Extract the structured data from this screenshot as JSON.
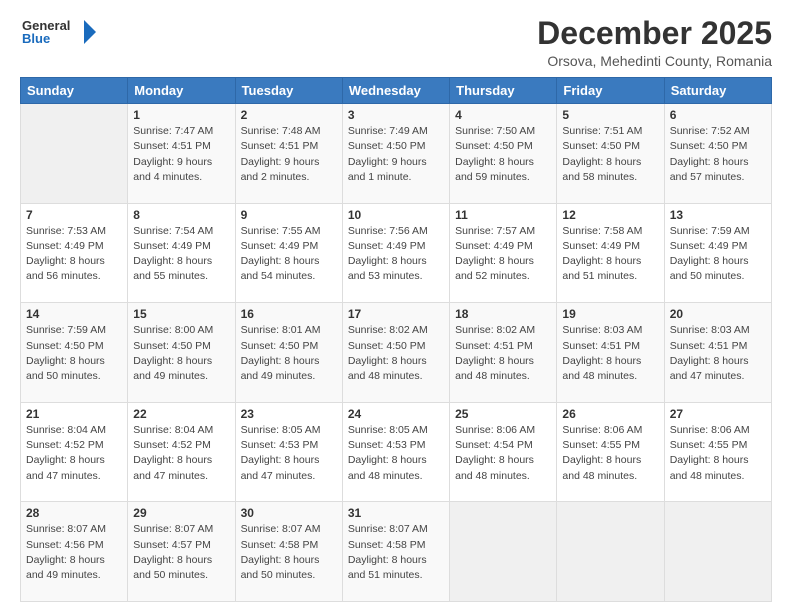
{
  "logo": {
    "line1": "General",
    "line2": "Blue"
  },
  "title": "December 2025",
  "subtitle": "Orsova, Mehedinti County, Romania",
  "days_header": [
    "Sunday",
    "Monday",
    "Tuesday",
    "Wednesday",
    "Thursday",
    "Friday",
    "Saturday"
  ],
  "weeks": [
    [
      {
        "num": "",
        "info": ""
      },
      {
        "num": "1",
        "info": "Sunrise: 7:47 AM\nSunset: 4:51 PM\nDaylight: 9 hours\nand 4 minutes."
      },
      {
        "num": "2",
        "info": "Sunrise: 7:48 AM\nSunset: 4:51 PM\nDaylight: 9 hours\nand 2 minutes."
      },
      {
        "num": "3",
        "info": "Sunrise: 7:49 AM\nSunset: 4:50 PM\nDaylight: 9 hours\nand 1 minute."
      },
      {
        "num": "4",
        "info": "Sunrise: 7:50 AM\nSunset: 4:50 PM\nDaylight: 8 hours\nand 59 minutes."
      },
      {
        "num": "5",
        "info": "Sunrise: 7:51 AM\nSunset: 4:50 PM\nDaylight: 8 hours\nand 58 minutes."
      },
      {
        "num": "6",
        "info": "Sunrise: 7:52 AM\nSunset: 4:50 PM\nDaylight: 8 hours\nand 57 minutes."
      }
    ],
    [
      {
        "num": "7",
        "info": "Sunrise: 7:53 AM\nSunset: 4:49 PM\nDaylight: 8 hours\nand 56 minutes."
      },
      {
        "num": "8",
        "info": "Sunrise: 7:54 AM\nSunset: 4:49 PM\nDaylight: 8 hours\nand 55 minutes."
      },
      {
        "num": "9",
        "info": "Sunrise: 7:55 AM\nSunset: 4:49 PM\nDaylight: 8 hours\nand 54 minutes."
      },
      {
        "num": "10",
        "info": "Sunrise: 7:56 AM\nSunset: 4:49 PM\nDaylight: 8 hours\nand 53 minutes."
      },
      {
        "num": "11",
        "info": "Sunrise: 7:57 AM\nSunset: 4:49 PM\nDaylight: 8 hours\nand 52 minutes."
      },
      {
        "num": "12",
        "info": "Sunrise: 7:58 AM\nSunset: 4:49 PM\nDaylight: 8 hours\nand 51 minutes."
      },
      {
        "num": "13",
        "info": "Sunrise: 7:59 AM\nSunset: 4:49 PM\nDaylight: 8 hours\nand 50 minutes."
      }
    ],
    [
      {
        "num": "14",
        "info": "Sunrise: 7:59 AM\nSunset: 4:50 PM\nDaylight: 8 hours\nand 50 minutes."
      },
      {
        "num": "15",
        "info": "Sunrise: 8:00 AM\nSunset: 4:50 PM\nDaylight: 8 hours\nand 49 minutes."
      },
      {
        "num": "16",
        "info": "Sunrise: 8:01 AM\nSunset: 4:50 PM\nDaylight: 8 hours\nand 49 minutes."
      },
      {
        "num": "17",
        "info": "Sunrise: 8:02 AM\nSunset: 4:50 PM\nDaylight: 8 hours\nand 48 minutes."
      },
      {
        "num": "18",
        "info": "Sunrise: 8:02 AM\nSunset: 4:51 PM\nDaylight: 8 hours\nand 48 minutes."
      },
      {
        "num": "19",
        "info": "Sunrise: 8:03 AM\nSunset: 4:51 PM\nDaylight: 8 hours\nand 48 minutes."
      },
      {
        "num": "20",
        "info": "Sunrise: 8:03 AM\nSunset: 4:51 PM\nDaylight: 8 hours\nand 47 minutes."
      }
    ],
    [
      {
        "num": "21",
        "info": "Sunrise: 8:04 AM\nSunset: 4:52 PM\nDaylight: 8 hours\nand 47 minutes."
      },
      {
        "num": "22",
        "info": "Sunrise: 8:04 AM\nSunset: 4:52 PM\nDaylight: 8 hours\nand 47 minutes."
      },
      {
        "num": "23",
        "info": "Sunrise: 8:05 AM\nSunset: 4:53 PM\nDaylight: 8 hours\nand 47 minutes."
      },
      {
        "num": "24",
        "info": "Sunrise: 8:05 AM\nSunset: 4:53 PM\nDaylight: 8 hours\nand 48 minutes."
      },
      {
        "num": "25",
        "info": "Sunrise: 8:06 AM\nSunset: 4:54 PM\nDaylight: 8 hours\nand 48 minutes."
      },
      {
        "num": "26",
        "info": "Sunrise: 8:06 AM\nSunset: 4:55 PM\nDaylight: 8 hours\nand 48 minutes."
      },
      {
        "num": "27",
        "info": "Sunrise: 8:06 AM\nSunset: 4:55 PM\nDaylight: 8 hours\nand 48 minutes."
      }
    ],
    [
      {
        "num": "28",
        "info": "Sunrise: 8:07 AM\nSunset: 4:56 PM\nDaylight: 8 hours\nand 49 minutes."
      },
      {
        "num": "29",
        "info": "Sunrise: 8:07 AM\nSunset: 4:57 PM\nDaylight: 8 hours\nand 50 minutes."
      },
      {
        "num": "30",
        "info": "Sunrise: 8:07 AM\nSunset: 4:58 PM\nDaylight: 8 hours\nand 50 minutes."
      },
      {
        "num": "31",
        "info": "Sunrise: 8:07 AM\nSunset: 4:58 PM\nDaylight: 8 hours\nand 51 minutes."
      },
      {
        "num": "",
        "info": ""
      },
      {
        "num": "",
        "info": ""
      },
      {
        "num": "",
        "info": ""
      }
    ]
  ]
}
